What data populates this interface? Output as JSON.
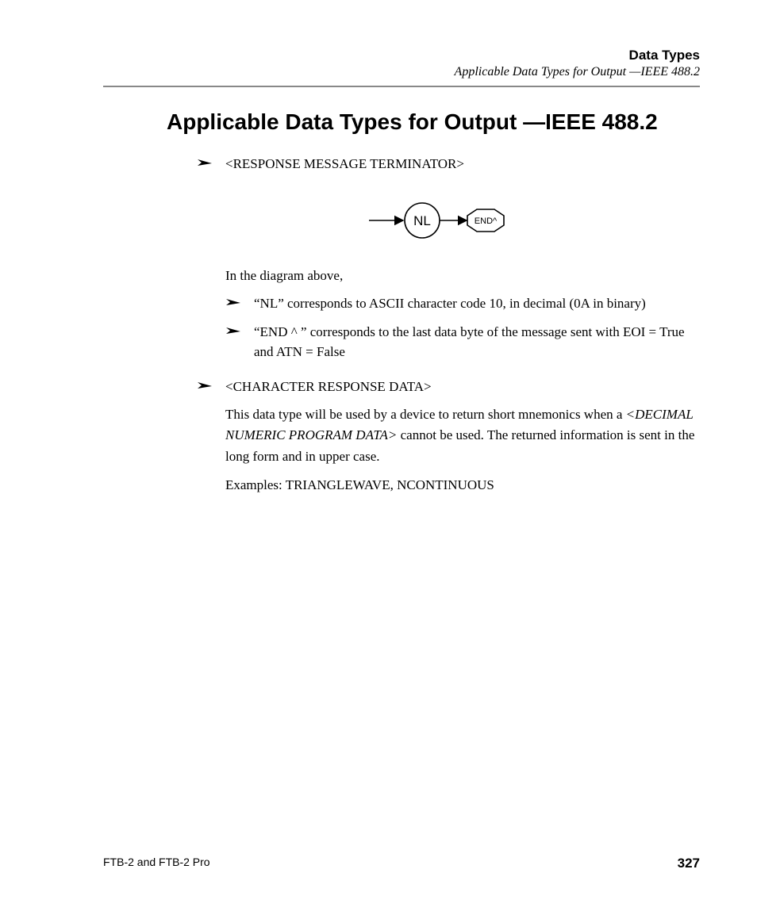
{
  "header": {
    "title": "Data Types",
    "subtitle": "Applicable Data Types for Output —IEEE 488.2"
  },
  "heading": "Applicable Data Types for Output —IEEE 488.2",
  "top1": "<RESPONSE MESSAGE TERMINATOR>",
  "diagram": {
    "node1": "NL",
    "node2": "END^"
  },
  "para_above": "In the diagram above,",
  "sub1": "“NL” corresponds to ASCII character code 10, in decimal (0A in binary)",
  "sub2": "“END ^ ” corresponds to the last data byte of the message sent with EOI = True and ATN =  False",
  "top2": "<CHARACTER RESPONSE DATA>",
  "desc_a": "This data type will be used by a device to return short mnemonics when a ",
  "desc_em": "<DECIMAL NUMERIC PROGRAM DATA>",
  "desc_b": " cannot be used. The returned information is sent in the long form and in upper case.",
  "examples": "Examples: TRIANGLEWAVE, NCONTINUOUS",
  "footer": {
    "left": "FTB-2 and FTB-2 Pro",
    "page": "327"
  }
}
